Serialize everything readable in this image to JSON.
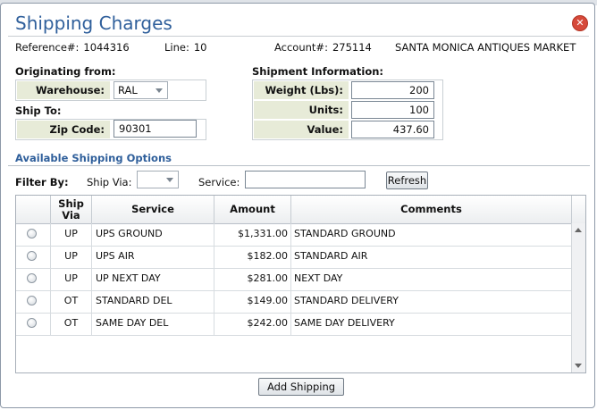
{
  "dialog": {
    "title": "Shipping Charges",
    "close_icon": "close-icon",
    "reference_label": "Reference#:",
    "reference_value": "1044316",
    "line_label": "Line:",
    "line_value": "10",
    "account_label": "Account#:",
    "account_value": "275114",
    "customer_name": "SANTA MONICA ANTIQUES MARKET"
  },
  "origin": {
    "section_label": "Originating from:",
    "warehouse_label": "Warehouse:",
    "warehouse_value": "RAL"
  },
  "ship_to": {
    "section_label": "Ship To:",
    "zip_label": "Zip Code:",
    "zip_value": "90301"
  },
  "shipment": {
    "section_label": "Shipment Information:",
    "weight_label": "Weight (Lbs):",
    "weight_value": "200",
    "units_label": "Units:",
    "units_value": "100",
    "value_label": "Value:",
    "value_value": "437.60"
  },
  "options": {
    "section_title": "Available Shipping Options",
    "filter_label": "Filter By:",
    "ship_via_label": "Ship Via:",
    "ship_via_value": "",
    "service_label": "Service:",
    "service_value": "",
    "refresh_label": "Refresh"
  },
  "grid": {
    "headers": [
      "Ship Via",
      "Service",
      "Amount",
      "Comments"
    ],
    "rows": [
      {
        "ship_via": "UP",
        "service": "UPS GROUND",
        "amount": "$1,331.00",
        "comments": "STANDARD GROUND"
      },
      {
        "ship_via": "UP",
        "service": "UPS AIR",
        "amount": "$182.00",
        "comments": "STANDARD AIR"
      },
      {
        "ship_via": "UP",
        "service": "UP NEXT DAY",
        "amount": "$281.00",
        "comments": "NEXT DAY"
      },
      {
        "ship_via": "OT",
        "service": "STANDARD DEL",
        "amount": "$149.00",
        "comments": "STANDARD DELIVERY"
      },
      {
        "ship_via": "OT",
        "service": "SAME DAY DEL",
        "amount": "$242.00",
        "comments": "SAME DAY DELIVERY"
      }
    ]
  },
  "footer": {
    "add_shipping_label": "Add Shipping"
  },
  "colors": {
    "title": "#2f5f9b",
    "label_bg": "#e7ebd8",
    "close": "#d6493a"
  }
}
